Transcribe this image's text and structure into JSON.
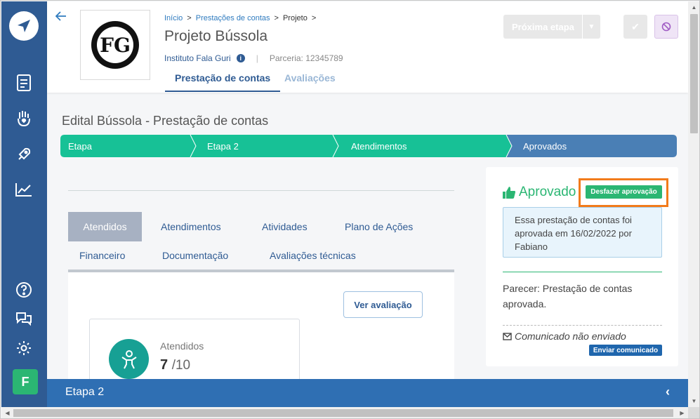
{
  "header": {
    "breadcrumb": [
      "Início",
      "Prestações de contas",
      "Projeto"
    ],
    "breadcrumb_sep": ">",
    "project_title": "Projeto Bússola",
    "institute": "Instituto Fala Guri",
    "partnership": "Parceria: 12345789",
    "tabs": [
      {
        "label": "Prestação de contas",
        "active": true
      },
      {
        "label": "Avaliações",
        "active": false
      }
    ],
    "next_step_label": "Próxima etapa",
    "logo_text": "FG"
  },
  "main": {
    "edital_title": "Edital Bússola - Prestação de contas",
    "pipeline": [
      {
        "label": "Etapa",
        "color": "#17c196"
      },
      {
        "label": "Etapa 2",
        "color": "#17c196"
      },
      {
        "label": "Atendimentos",
        "color": "#17c196"
      },
      {
        "label": "Aprovados",
        "color": "#4a7fb5"
      }
    ],
    "tabs": [
      {
        "label": "Atendidos",
        "active": true
      },
      {
        "label": "Atendimentos",
        "active": false
      },
      {
        "label": "Atividades",
        "active": false
      },
      {
        "label": "Plano de Ações",
        "active": false
      },
      {
        "label": "Financeiro",
        "active": false
      },
      {
        "label": "Documentação",
        "active": false
      },
      {
        "label": "Avaliações técnicas",
        "active": false
      }
    ],
    "view_button": "Ver avaliação",
    "stat": {
      "label": "Atendidos",
      "value": "7",
      "total": "/10"
    }
  },
  "approval": {
    "status": "Aprovado",
    "undo_button": "Desfazer aprovação",
    "info": "Essa prestação de contas foi aprovada em 16/02/2022 por Fabiano",
    "opinion": "Parecer: Prestação de contas aprovada.",
    "communication": "Comunicado não enviado",
    "send_button": "Enviar comunicado"
  },
  "bottom_bar": {
    "label": "Etapa 2"
  },
  "sidebar": {
    "avatar_letter": "F"
  },
  "colors": {
    "accent": "#2f5b93",
    "success": "#2bb673",
    "highlight": "#f27b1b"
  }
}
